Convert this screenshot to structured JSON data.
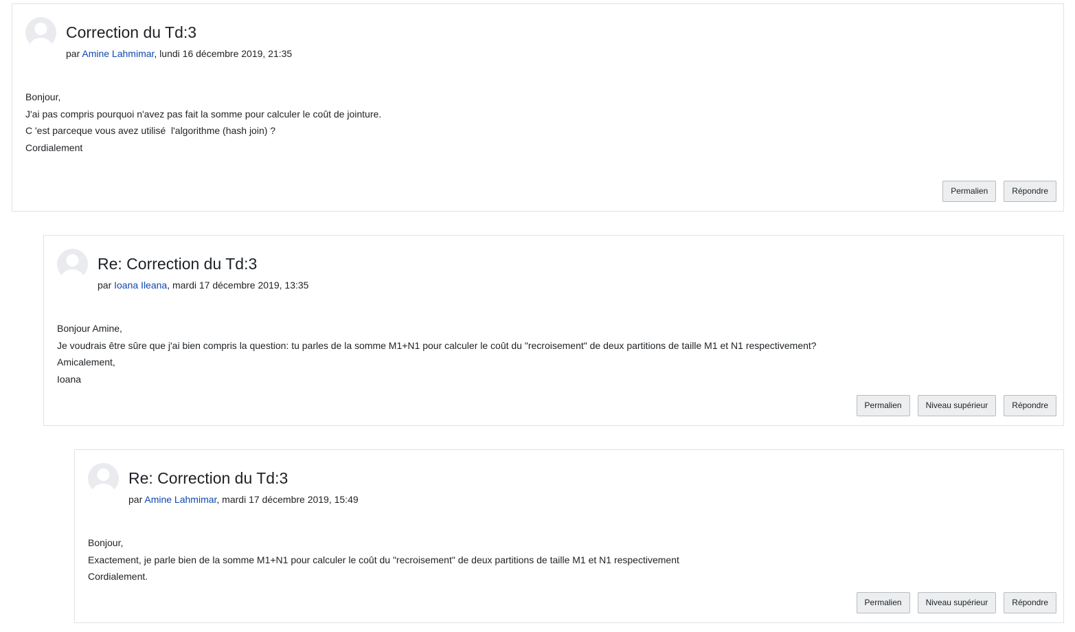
{
  "posts": [
    {
      "subject": "Correction du Td:3",
      "by_prefix": "par ",
      "author": "Amine Lahmimar",
      "date": ", lundi 16 décembre 2019, 21:35",
      "lines": [
        "Bonjour,",
        "J'ai pas compris pourquoi n'avez pas fait la somme pour calculer le coût de jointure.",
        "C 'est parceque vous avez utilisé  l'algorithme (hash join) ?",
        "Cordialement"
      ],
      "actions": {
        "permalink": "Permalien",
        "reply": "Répondre"
      }
    },
    {
      "subject": "Re: Correction du Td:3",
      "by_prefix": "par ",
      "author": "Ioana Ileana",
      "date": ", mardi 17 décembre 2019, 13:35",
      "lines": [
        "Bonjour Amine,",
        "Je voudrais être sûre que j'ai bien compris la question: tu parles de la somme M1+N1 pour calculer le coût du \"recroisement\" de deux partitions de taille M1 et N1 respectivement?",
        "Amicalement,",
        "Ioana"
      ],
      "actions": {
        "permalink": "Permalien",
        "parent": "Niveau supérieur",
        "reply": "Répondre"
      }
    },
    {
      "subject": "Re: Correction du Td:3",
      "by_prefix": "par ",
      "author": "Amine Lahmimar",
      "date": ", mardi 17 décembre 2019, 15:49",
      "lines": [
        "Bonjour,",
        "Exactement, je parle bien de la somme M1+N1 pour calculer le coût du \"recroisement\" de deux partitions de taille M1 et N1 respectivement",
        "Cordialement."
      ],
      "actions": {
        "permalink": "Permalien",
        "parent": "Niveau supérieur",
        "reply": "Répondre"
      }
    }
  ],
  "icons": {
    "avatar": "default-user-avatar-icon"
  }
}
